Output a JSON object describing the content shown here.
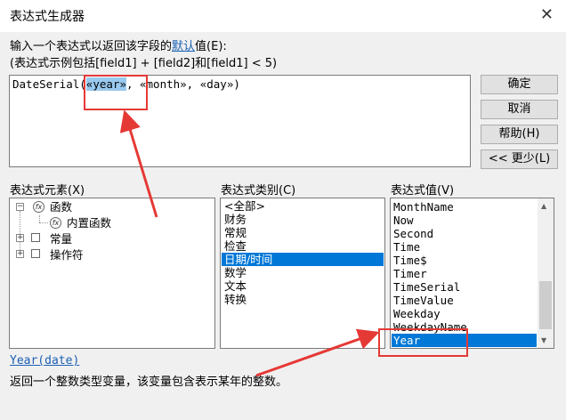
{
  "window": {
    "title": "表达式生成器",
    "close_glyph": "✕"
  },
  "description": {
    "line1_prefix": "输入一个表达式以返回该字段的",
    "line1_link": "默认",
    "line1_suffix": "值(E):",
    "line2": "(表达式示例包括[field1] + [field2]和[field1] < 5)"
  },
  "expression": {
    "prefix": "DateSerial(",
    "selected": "«year»",
    "suffix": ", «month», «day»)"
  },
  "buttons": {
    "ok": "确定",
    "cancel": "取消",
    "help": "帮助(H)",
    "less": "<< 更少(L)"
  },
  "elements": {
    "label": "表达式元素(X)",
    "items": [
      {
        "label": "函数",
        "expander": "−"
      },
      {
        "label": "内置函数"
      },
      {
        "label": "常量",
        "expander": "+"
      },
      {
        "label": "操作符",
        "expander": "+"
      }
    ]
  },
  "categories": {
    "label": "表达式类别(C)",
    "items": [
      "<全部>",
      "财务",
      "常规",
      "检查",
      "日期/时间",
      "数学",
      "文本",
      "转换"
    ],
    "selected_index": 4
  },
  "values": {
    "label": "表达式值(V)",
    "items": [
      "MonthName",
      "Now",
      "Second",
      "Time",
      "Time$",
      "Timer",
      "TimeSerial",
      "TimeValue",
      "Weekday",
      "WeekdayName",
      "Year"
    ],
    "selected_index": 10
  },
  "footer": {
    "function_signature": "Year(date)",
    "function_description": "返回一个整数类型变量，该变量包含表示某年的整数。"
  },
  "colors": {
    "selection": "#0078d7",
    "annotation_red": "#e53935",
    "link": "#1a5fb4"
  }
}
